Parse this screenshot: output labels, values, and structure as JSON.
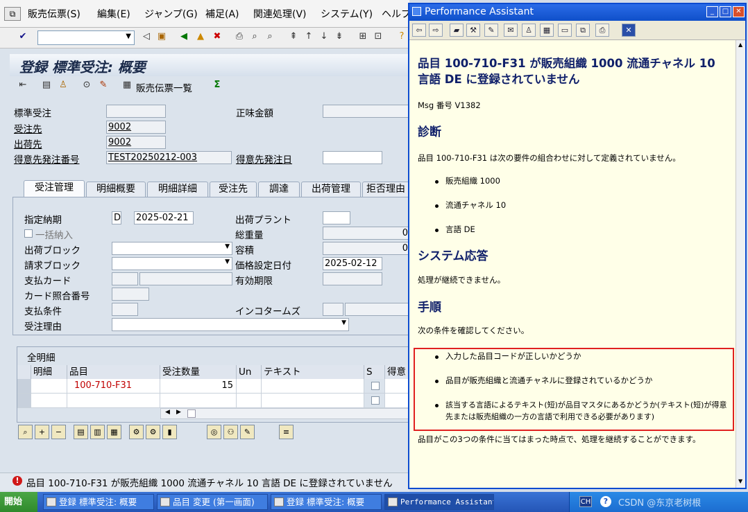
{
  "menubar": [
    "販売伝票(S)",
    "編集(E)",
    "ジャンプ(G)",
    "補足(A)",
    "関連処理(V)",
    "システム(Y)",
    "ヘルプ"
  ],
  "screen_title": "登録 標準受注: 概要",
  "toolbar2": {
    "doc_list_label": "販売伝票一覧"
  },
  "header_fields": {
    "order_type_label": "標準受注",
    "order_type_value": "",
    "net_value_label": "正味金額",
    "net_value_value": "",
    "sold_to_label": "受注先",
    "sold_to_value": "9002",
    "ship_to_label": "出荷先",
    "ship_to_value": "9002",
    "po_number_label": "得意先発注番号",
    "po_number_value": "TEST20250212-003",
    "po_date_label": "得意先発注日",
    "po_date_value": ""
  },
  "tabs": [
    "受注管理",
    "明細概要",
    "明細詳細",
    "受注先",
    "調達",
    "出荷管理",
    "拒否理由"
  ],
  "sales_tab": {
    "req_delivery_date_label": "指定納期",
    "req_delivery_date_type": "D",
    "req_delivery_date_value": "2025-02-21",
    "delivering_plant_label": "出荷プラント",
    "complete_dlv_label": "一括納入",
    "total_weight_label": "総重量",
    "total_weight_value": "0",
    "delivery_block_label": "出荷ブロック",
    "volume_label": "容積",
    "volume_value": "0",
    "billing_block_label": "請求ブロック",
    "pricing_date_label": "価格設定日付",
    "pricing_date_value": "2025-02-12",
    "payment_card_label": "支払カード",
    "valid_to_label": "有効期限",
    "card_verif_label": "カード照合番号",
    "payment_terms_label": "支払条件",
    "incoterms_label": "インコタームズ",
    "order_reason_label": "受注理由"
  },
  "items": {
    "title": "全明細",
    "columns": [
      "明細",
      "品目",
      "受注数量",
      "Un",
      "テキスト",
      "S",
      "得意"
    ],
    "rows": [
      {
        "item": "",
        "material": "100-710-F31",
        "qty": "15",
        "un": "",
        "text": ""
      },
      {
        "item": "",
        "material": "",
        "qty": "",
        "un": "",
        "text": ""
      }
    ]
  },
  "status_message": "品目 100-710-F31 が販売組織 1000 流通チャネル 10 言語 DE に登録されていません",
  "pa": {
    "title": "Performance Assistant",
    "heading_line1": "品目 100-710-F31 が販売組織 1000 流通チャネル 10",
    "heading_line2": "言語 DE に登録されていません",
    "msg_no": "Msg 番号 V1382",
    "diag_title": "診断",
    "diag_text": "品目 100-710-F31 は次の要件の組合わせに対して定義されていません。",
    "diag_items": [
      "販売組織 1000",
      "流通チャネル 10",
      "言語 DE"
    ],
    "sys_title": "システム応答",
    "sys_text": "処理が継続できません。",
    "proc_title": "手順",
    "proc_text": "次の条件を確認してください。",
    "proc_items": [
      "入力した品目コードが正しいかどうか",
      "品目が販売組織と流通チャネルに登録されているかどうか",
      "該当する言語によるテキスト(短)が品目マスタにあるかどうか(テキスト(短)が得意",
      "先または販売組織の一方の言語で利用できる必要があります)"
    ],
    "footer_text": "品目がこの3つの条件に当てはまった時点で、処理を継続することができます。"
  },
  "taskbar": {
    "start": "開始",
    "tasks": [
      "登録 標準受注: 概要",
      "品目 変更 (第一画面)",
      "登録 標準受注: 概要",
      "Performance Assistant"
    ],
    "tray_lang": "CH",
    "watermark": "CSDN @东京老树根"
  }
}
